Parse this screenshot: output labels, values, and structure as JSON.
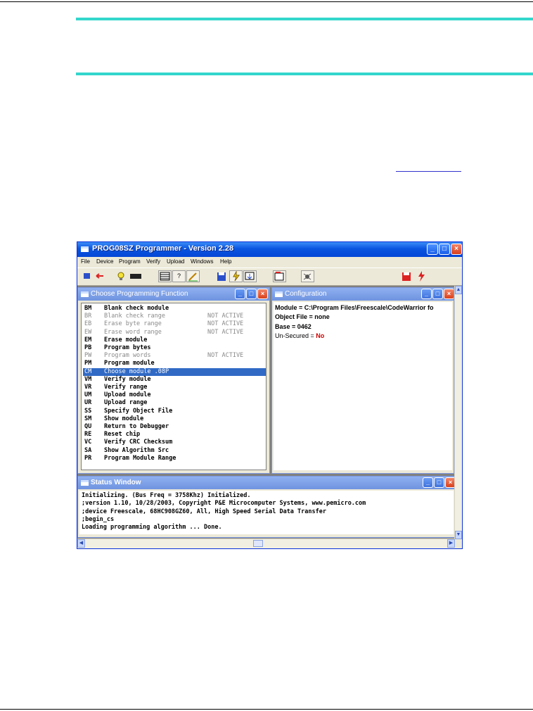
{
  "app": {
    "title": "PROG08SZ Programmer - Version 2.28",
    "menu": [
      "File",
      "Device",
      "Program",
      "Verify",
      "Upload",
      "Windows",
      "Help"
    ]
  },
  "toolbar_icons": [
    "connect-icon",
    "bulb-icon",
    "chip-icon",
    "grid-icon",
    "help-icon",
    "pen-icon",
    "save-icon",
    "flash-icon",
    "download-icon",
    "upload-icon",
    "bug-icon",
    "disk-icon",
    "power-icon"
  ],
  "programming_window": {
    "title": "Choose Programming Function",
    "items": [
      {
        "code": "BM",
        "label": "Blank check module",
        "status": ""
      },
      {
        "code": "BR",
        "label": "Blank check range",
        "status": "NOT ACTIVE"
      },
      {
        "code": "EB",
        "label": "Erase byte range",
        "status": "NOT ACTIVE"
      },
      {
        "code": "EW",
        "label": "Erase word range",
        "status": "NOT ACTIVE"
      },
      {
        "code": "EM",
        "label": "Erase module",
        "status": ""
      },
      {
        "code": "PB",
        "label": "Program bytes",
        "status": ""
      },
      {
        "code": "PW",
        "label": "Program words",
        "status": "NOT ACTIVE"
      },
      {
        "code": "PM",
        "label": "Program module",
        "status": ""
      },
      {
        "code": "CM",
        "label": "Choose module .08P",
        "status": ""
      },
      {
        "code": "VM",
        "label": "Verify module",
        "status": ""
      },
      {
        "code": "VR",
        "label": "Verify range",
        "status": ""
      },
      {
        "code": "UM",
        "label": "Upload module",
        "status": ""
      },
      {
        "code": "UR",
        "label": "Upload range",
        "status": ""
      },
      {
        "code": "SS",
        "label": "Specify Object File",
        "status": ""
      },
      {
        "code": "SM",
        "label": "Show module",
        "status": ""
      },
      {
        "code": "QU",
        "label": "Return to Debugger",
        "status": ""
      },
      {
        "code": "RE",
        "label": "Reset chip",
        "status": ""
      },
      {
        "code": "VC",
        "label": "Verify CRC Checksum",
        "status": ""
      },
      {
        "code": "SA",
        "label": "Show Algorithm Src",
        "status": ""
      },
      {
        "code": "PR",
        "label": "Program Module Range",
        "status": ""
      }
    ]
  },
  "config_window": {
    "title": "Configuration",
    "module_line": "Module = C:\\Program Files\\Freescale\\CodeWarrior fo",
    "object_line": "Object File = none",
    "base_line": "Base = 0462",
    "secured_label": "Un-Secured = ",
    "secured_value": "No"
  },
  "status_window": {
    "title": "Status Window",
    "lines": [
      "Initializing.  (Bus Freq = 3758Khz)  Initialized.",
      ";version 1.10, 10/28/2003, Copyright P&E Microcomputer Systems, www.pemicro.com",
      ";device Freescale, 68HC908GZ60, All, High Speed Serial Data Transfer",
      ";begin_cs",
      "Loading programming algorithm ... Done."
    ]
  },
  "colors": {
    "accent_rule": "#33d6cc",
    "title_blue": "#0a55e0",
    "selection": "#316ac5",
    "secured_red": "#cc0000"
  }
}
